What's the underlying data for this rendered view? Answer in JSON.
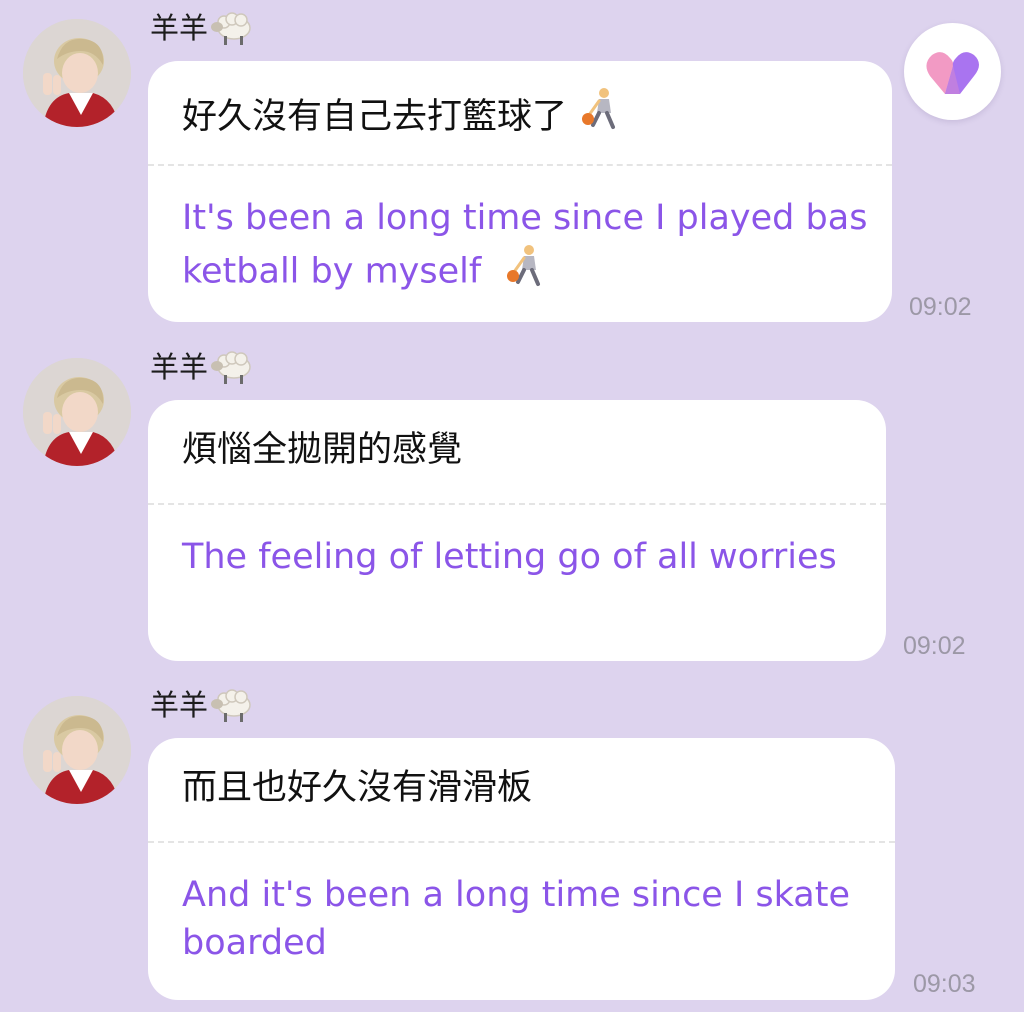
{
  "messages": [
    {
      "sender": "羊羊",
      "sender_icon": "sheep-icon",
      "original": "好久沒有自己去打籃球了",
      "original_icon": "basketball-player-icon",
      "translation": "It's been a long time since I played basketball by myself",
      "translation_icon": "basketball-player-icon",
      "time": "09:02"
    },
    {
      "sender": "羊羊",
      "sender_icon": "sheep-icon",
      "original": "煩惱全拋開的感覺",
      "translation": "The feeling of letting go of all worries",
      "time": "09:02"
    },
    {
      "sender": "羊羊",
      "sender_icon": "sheep-icon",
      "original": "而且也好久沒有滑滑板",
      "translation": "And it's been a long time since I skateboarded",
      "time": "09:03"
    }
  ],
  "reaction_button": {
    "icon": "heart-icon",
    "colors": [
      "#f29ac4",
      "#a974f0"
    ]
  },
  "colors": {
    "background": "#ddd3ee",
    "bubble": "#ffffff",
    "translation_text": "#8b55e8",
    "timestamp": "#9c98a6"
  }
}
